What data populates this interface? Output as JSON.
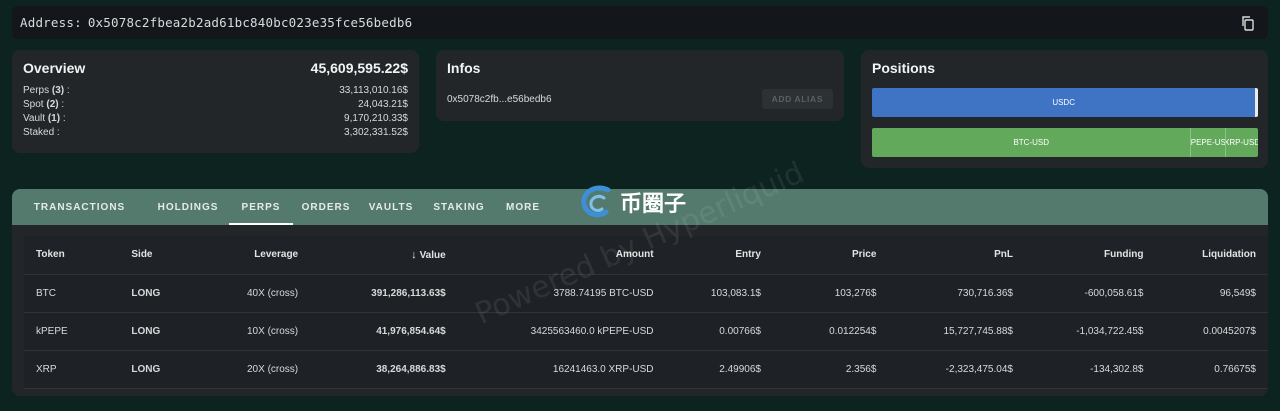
{
  "address": {
    "label": "Address:",
    "value": "0x5078c2fbea2b2ad61bc840bc023e35fce56bedb6"
  },
  "overview": {
    "title": "Overview",
    "total": "45,609,595.22$",
    "rows": [
      {
        "label": "Perps",
        "count": "(3)",
        "value": "33,113,010.16$"
      },
      {
        "label": "Spot",
        "count": "(2)",
        "value": "24,043.21$"
      },
      {
        "label": "Vault",
        "count": "(1)",
        "value": "9,170,210.33$"
      },
      {
        "label": "Staked",
        "count": "",
        "value": "3,302,331.52$"
      }
    ]
  },
  "infos": {
    "title": "Infos",
    "short_address": "0x5078c2fb...e56bedb6",
    "alias_button": "ADD ALIAS"
  },
  "positions_card": {
    "title": "Positions",
    "bar1": [
      {
        "label": "USDC",
        "fraction": 0.993,
        "color": "#3f73c4"
      },
      {
        "label": "",
        "fraction": 0.007,
        "color": "#e6ecef"
      }
    ],
    "bar2": [
      {
        "label": "BTC-USD",
        "fraction": 0.825,
        "color": "#63a95b"
      },
      {
        "label": "PEPE-US",
        "fraction": 0.09,
        "color": "#63a95b"
      },
      {
        "label": "XRP-USD",
        "fraction": 0.085,
        "color": "#63a95b"
      }
    ]
  },
  "tabs": [
    {
      "label": "TRANSACTIONS",
      "active": false
    },
    {
      "label": "HOLDINGS",
      "active": false
    },
    {
      "label": "PERPS",
      "active": true
    },
    {
      "label": "ORDERS",
      "active": false
    },
    {
      "label": "VAULTS",
      "active": false
    },
    {
      "label": "STAKING",
      "active": false
    },
    {
      "label": "MORE",
      "active": false
    }
  ],
  "watermark": {
    "logo_text": "币圈子",
    "diagonal_text": "Powered by Hyperliquid"
  },
  "table": {
    "columns": [
      "Token",
      "Side",
      "Leverage",
      "Value",
      "Amount",
      "Entry",
      "Price",
      "PnL",
      "Funding",
      "Liquidation"
    ],
    "sort_column": "Value",
    "rows": [
      {
        "token": "BTC",
        "side": "LONG",
        "leverage": "40X (cross)",
        "value": "391,286,113.63$",
        "amount": "3788.74195 BTC-USD",
        "entry": "103,083.1$",
        "price": "103,276$",
        "pnl": "730,716.36$",
        "pnl_sign": "pos",
        "funding": "-600,058.61$",
        "liquidation": "96,549$"
      },
      {
        "token": "kPEPE",
        "side": "LONG",
        "leverage": "10X (cross)",
        "value": "41,976,854.64$",
        "amount": "3425563460.0 kPEPE-USD",
        "entry": "0.00766$",
        "price": "0.012254$",
        "pnl": "15,727,745.88$",
        "pnl_sign": "pos",
        "funding": "-1,034,722.45$",
        "liquidation": "0.0045207$"
      },
      {
        "token": "XRP",
        "side": "LONG",
        "leverage": "20X (cross)",
        "value": "38,264,886.83$",
        "amount": "16241463.0 XRP-USD",
        "entry": "2.49906$",
        "price": "2.356$",
        "pnl": "-2,323,475.04$",
        "pnl_sign": "neg",
        "funding": "-134,302.8$",
        "liquidation": "0.76675$"
      }
    ]
  }
}
